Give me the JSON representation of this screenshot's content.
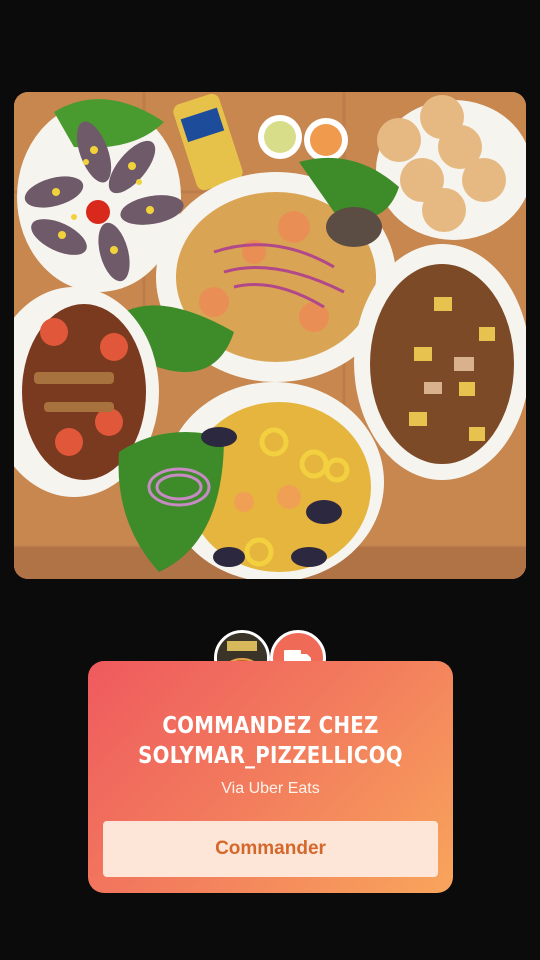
{
  "story": {
    "photo_alt": "photo",
    "sticker": {
      "title_line1": "COMMANDEZ CHEZ",
      "title_line2": "SOLYMAR_PIZZELLICOQ",
      "via_prefix": "Via",
      "via_service": "Uber Eats",
      "button_label": "Commander",
      "logo_icon": "restaurant-logo-icon",
      "delivery_icon": "delivery-truck-icon"
    },
    "colors": {
      "gradient_start": "#ef5a5e",
      "gradient_end": "#f8a55c",
      "button_text": "#d4682c",
      "button_bg": "#fde6d7"
    }
  }
}
